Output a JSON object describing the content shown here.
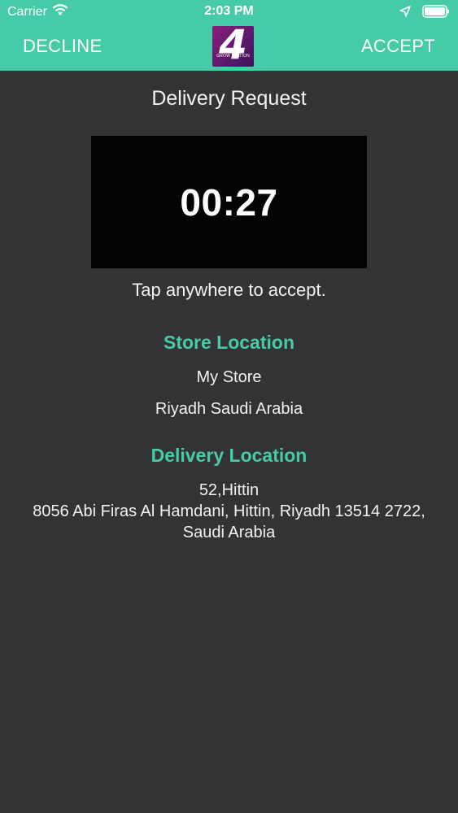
{
  "status_bar": {
    "carrier": "Carrier",
    "time": "2:03 PM",
    "icons": [
      "wifi-icon",
      "location-arrow-icon",
      "battery-icon"
    ]
  },
  "nav": {
    "decline_label": "DECLINE",
    "accept_label": "ACCEPT",
    "logo_digit": "4",
    "logo_text": "GROW STATION"
  },
  "request": {
    "title": "Delivery Request",
    "timer": "00:27",
    "hint": "Tap anywhere to accept."
  },
  "store": {
    "heading": "Store  Location",
    "name": "My Store",
    "address": "Riyadh Saudi Arabia"
  },
  "delivery": {
    "heading": "Delivery Location",
    "line1": "52,Hittin",
    "line2": "8056 Abi Firas Al Hamdani,  Hittin,  Riyadh 13514 2722,",
    "line3": "Saudi Arabia"
  },
  "colors": {
    "accent": "#46cba7",
    "background": "#333335",
    "timer_box": "#020202",
    "logo": "#6a1a72"
  }
}
